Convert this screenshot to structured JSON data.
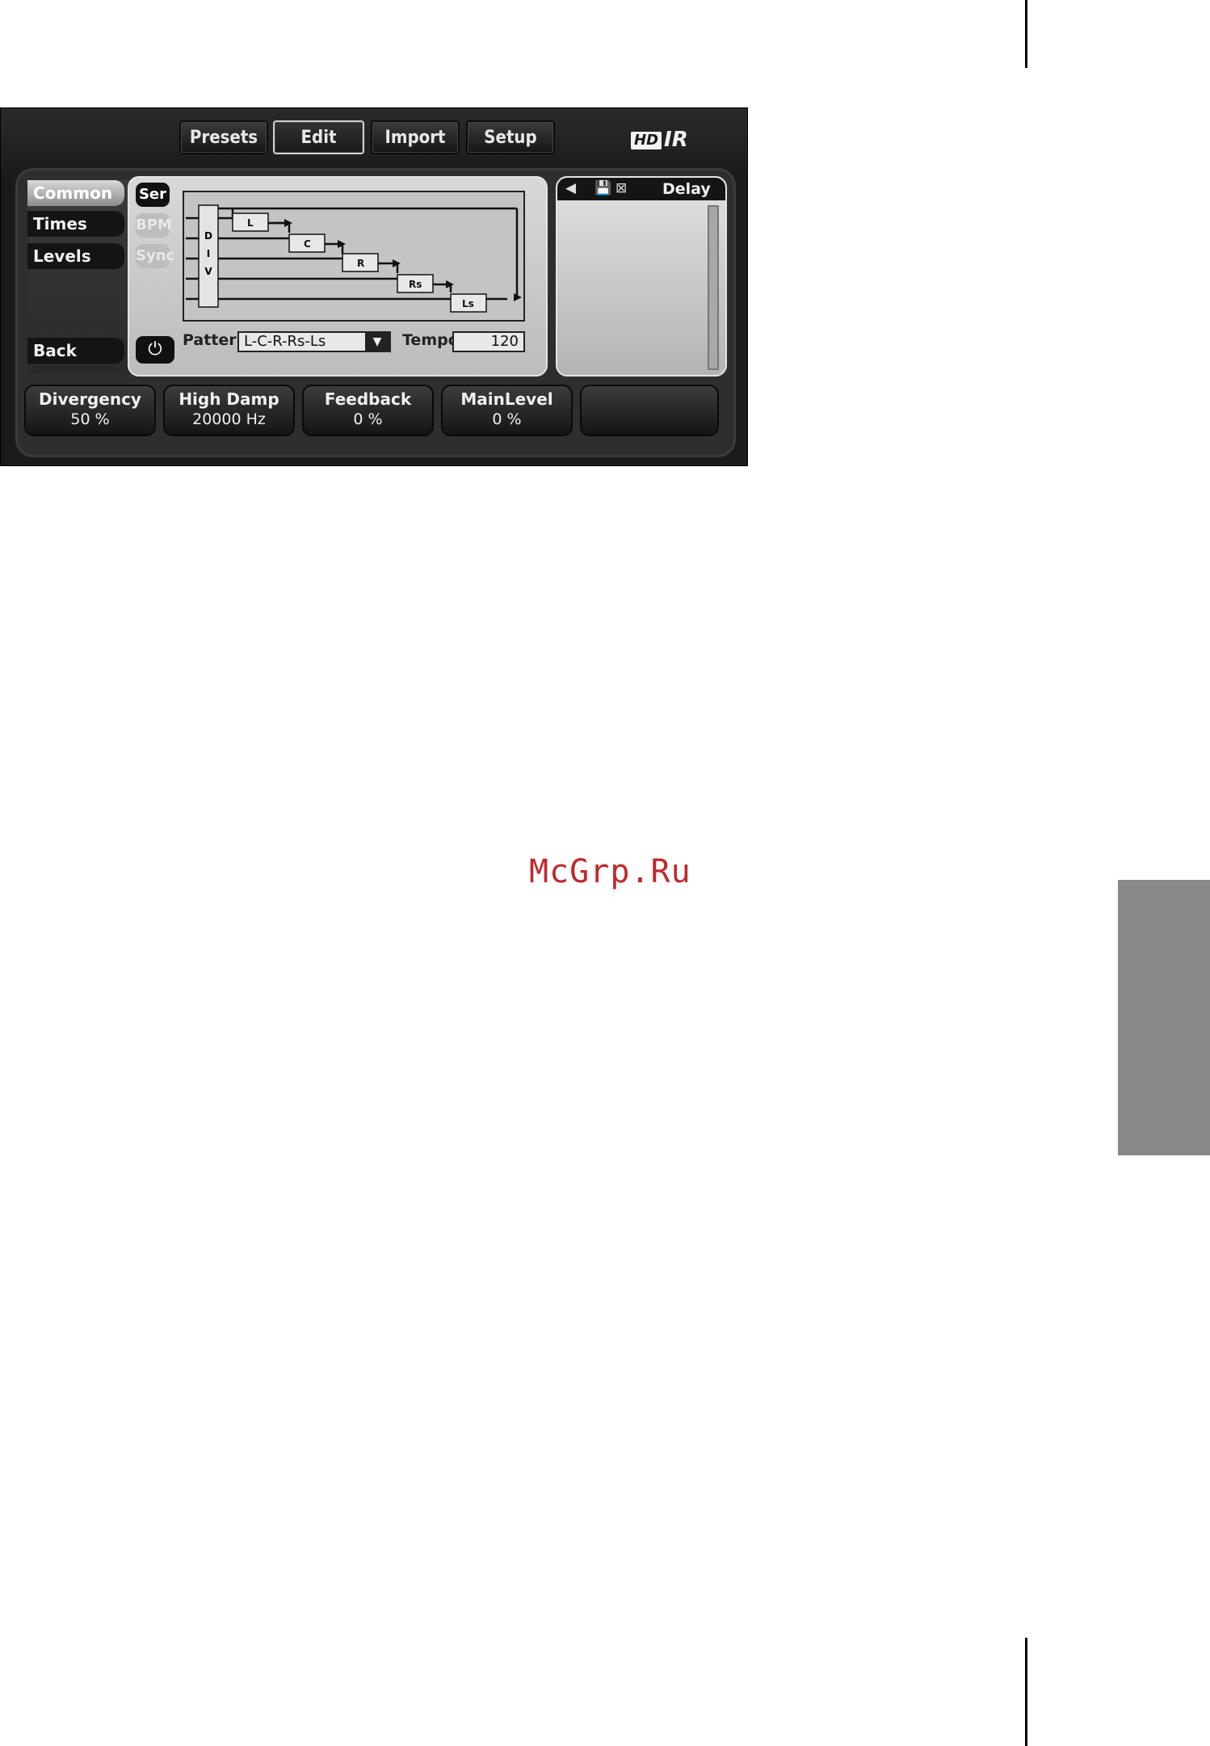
{
  "toolbar": {
    "presets": "Presets",
    "edit": "Edit",
    "import": "Import",
    "setup": "Setup"
  },
  "logo": {
    "hd": "HD",
    "ir": "IR"
  },
  "sidebar": {
    "items": [
      "Common",
      "Times",
      "Levels"
    ],
    "back": "Back"
  },
  "modes": {
    "ser": "Ser",
    "bpm": "BPM",
    "sync": "Sync",
    "power_icon": "power-icon"
  },
  "diagram": {
    "div_letters": [
      "D",
      "I",
      "V"
    ],
    "channels": [
      "L",
      "C",
      "R",
      "Rs",
      "Ls"
    ]
  },
  "pattern": {
    "label": "Pattern",
    "value": "L-C-R-Rs-Ls"
  },
  "tempo": {
    "label": "Tempo",
    "value": "120"
  },
  "right_panel": {
    "title": "Delay",
    "icons": [
      "back-icon",
      "save-icon",
      "close-icon"
    ]
  },
  "knobs": [
    {
      "name": "Divergency",
      "value": "50 %"
    },
    {
      "name": "High Damp",
      "value": "20000 Hz"
    },
    {
      "name": "Feedback",
      "value": "0 %"
    },
    {
      "name": "MainLevel",
      "value": "0 %"
    },
    {
      "name": "",
      "value": ""
    }
  ],
  "watermark": "McGrp.Ru",
  "colors": {
    "page": "#ffffff",
    "side_tab": "#888888",
    "watermark": "#c0282d",
    "plugin_bg": "#1a1a1a"
  }
}
